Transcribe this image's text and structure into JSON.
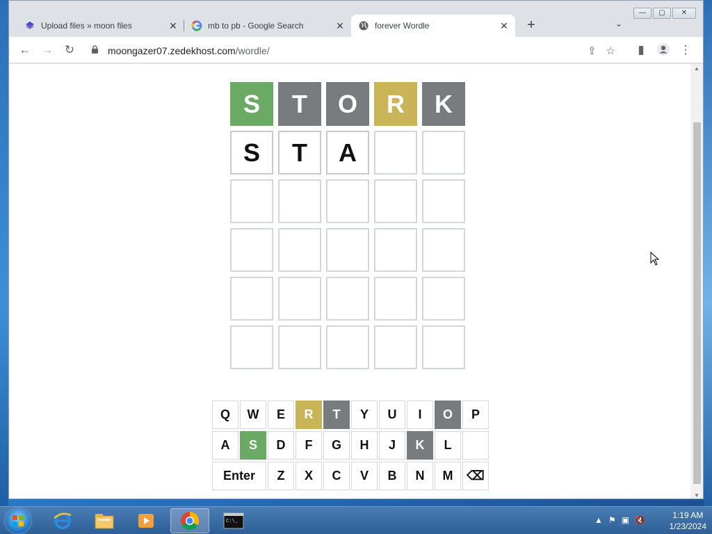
{
  "browser": {
    "tabs": [
      {
        "title": "Upload files » moon files",
        "favicon": "moon-files-icon"
      },
      {
        "title": "mb to pb - Google Search",
        "favicon": "google-icon"
      },
      {
        "title": "forever Wordle",
        "favicon": "globe-icon",
        "active": true
      }
    ],
    "new_tab": "+",
    "tab_search": "⌄",
    "url_host": "moongazer07.zedekhost.com",
    "url_path": "/wordle/"
  },
  "wordle": {
    "board": [
      [
        {
          "letter": "S",
          "state": "green"
        },
        {
          "letter": "T",
          "state": "gray"
        },
        {
          "letter": "O",
          "state": "gray"
        },
        {
          "letter": "R",
          "state": "yellow"
        },
        {
          "letter": "K",
          "state": "gray"
        }
      ],
      [
        {
          "letter": "S",
          "state": "filled"
        },
        {
          "letter": "T",
          "state": "filled"
        },
        {
          "letter": "A",
          "state": "filled"
        },
        {
          "letter": "",
          "state": "empty"
        },
        {
          "letter": "",
          "state": "empty"
        }
      ],
      [
        {
          "letter": "",
          "state": "empty"
        },
        {
          "letter": "",
          "state": "empty"
        },
        {
          "letter": "",
          "state": "empty"
        },
        {
          "letter": "",
          "state": "empty"
        },
        {
          "letter": "",
          "state": "empty"
        }
      ],
      [
        {
          "letter": "",
          "state": "empty"
        },
        {
          "letter": "",
          "state": "empty"
        },
        {
          "letter": "",
          "state": "empty"
        },
        {
          "letter": "",
          "state": "empty"
        },
        {
          "letter": "",
          "state": "empty"
        }
      ],
      [
        {
          "letter": "",
          "state": "empty"
        },
        {
          "letter": "",
          "state": "empty"
        },
        {
          "letter": "",
          "state": "empty"
        },
        {
          "letter": "",
          "state": "empty"
        },
        {
          "letter": "",
          "state": "empty"
        }
      ],
      [
        {
          "letter": "",
          "state": "empty"
        },
        {
          "letter": "",
          "state": "empty"
        },
        {
          "letter": "",
          "state": "empty"
        },
        {
          "letter": "",
          "state": "empty"
        },
        {
          "letter": "",
          "state": "empty"
        }
      ]
    ],
    "keyboard": [
      [
        {
          "key": "Q"
        },
        {
          "key": "W"
        },
        {
          "key": "E"
        },
        {
          "key": "R",
          "state": "yellow"
        },
        {
          "key": "T",
          "state": "gray"
        },
        {
          "key": "Y"
        },
        {
          "key": "U"
        },
        {
          "key": "I"
        },
        {
          "key": "O",
          "state": "gray"
        },
        {
          "key": "P"
        }
      ],
      [
        {
          "key": "A"
        },
        {
          "key": "S",
          "state": "green"
        },
        {
          "key": "D"
        },
        {
          "key": "F"
        },
        {
          "key": "G"
        },
        {
          "key": "H"
        },
        {
          "key": "J"
        },
        {
          "key": "K",
          "state": "gray"
        },
        {
          "key": "L"
        },
        {
          "key": ""
        }
      ],
      [
        {
          "key": "Enter",
          "wide": true
        },
        {
          "key": "Z"
        },
        {
          "key": "X"
        },
        {
          "key": "C"
        },
        {
          "key": "V"
        },
        {
          "key": "B"
        },
        {
          "key": "N"
        },
        {
          "key": "M"
        },
        {
          "key": "⌫"
        }
      ]
    ]
  },
  "colors": {
    "green": "#6aaa64",
    "yellow": "#c9b458",
    "gray": "#787c7e"
  },
  "taskbar": {
    "apps": [
      "internet-explorer-icon",
      "file-explorer-icon",
      "media-player-icon",
      "chrome-icon",
      "command-prompt-icon"
    ],
    "time": "1:19 AM",
    "date": "1/23/2024"
  }
}
